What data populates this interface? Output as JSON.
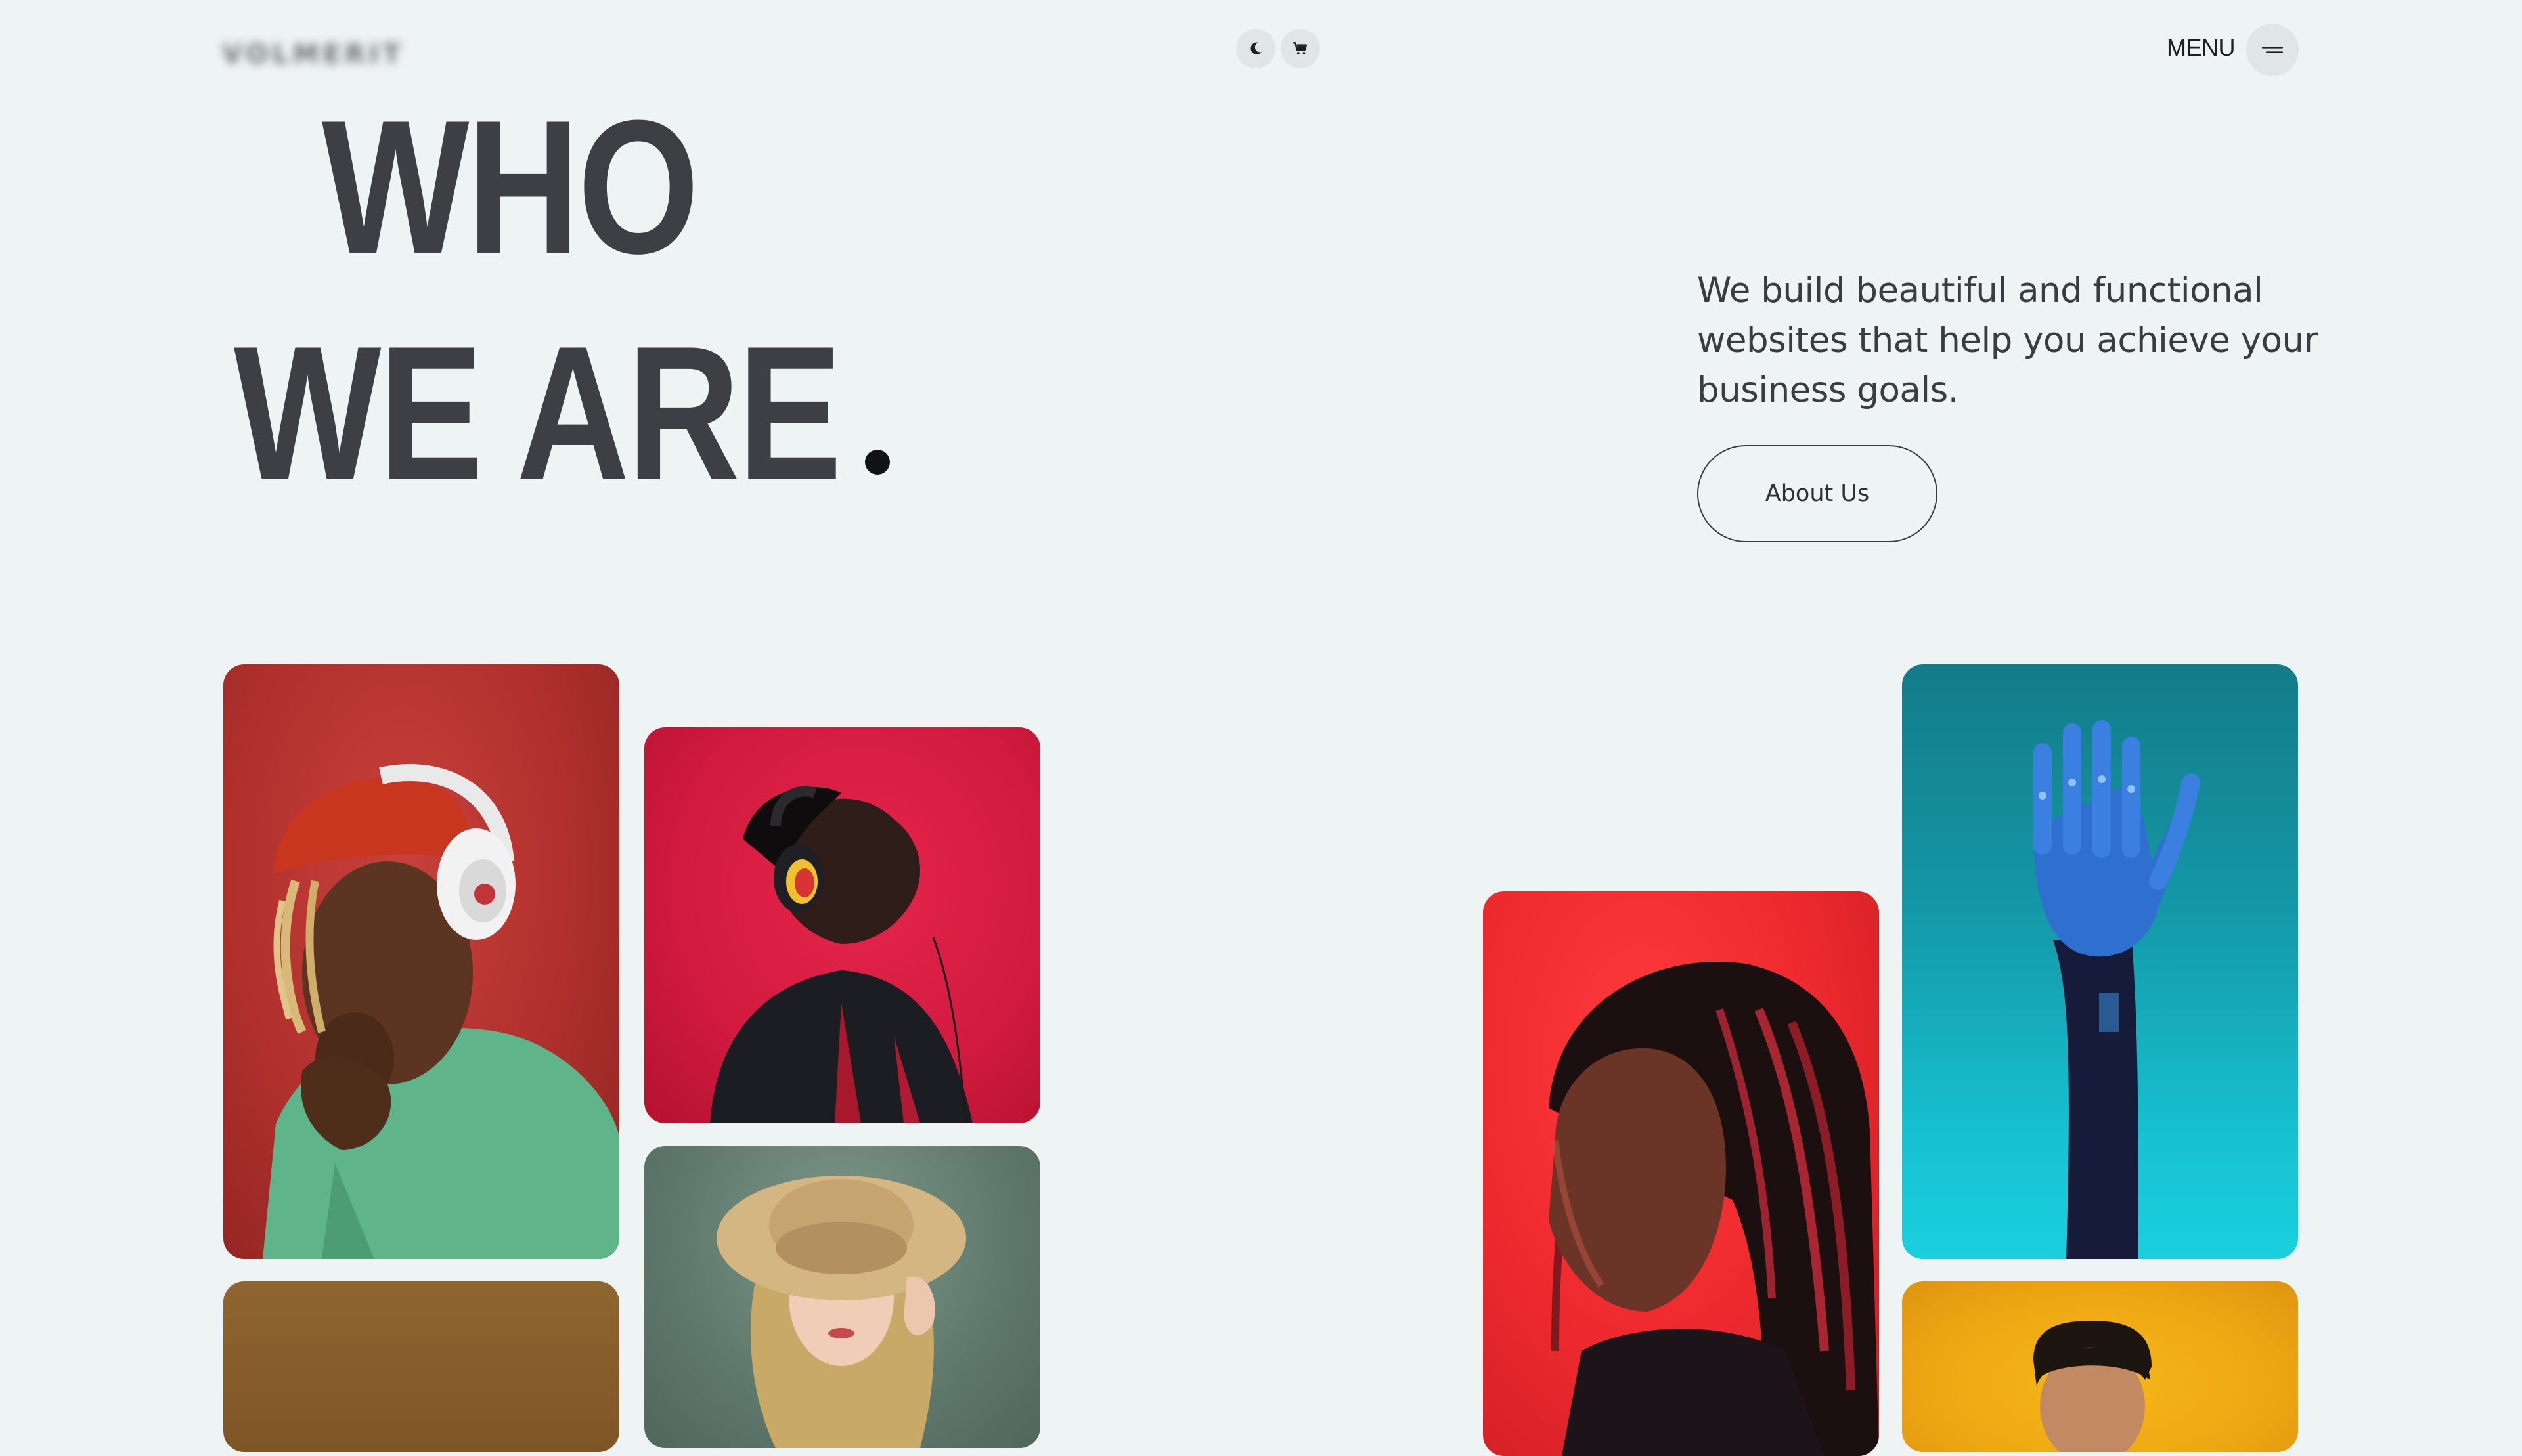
{
  "header": {
    "logo_text": "VOLMERIT",
    "menu_label": "MENU",
    "icons": {
      "theme": "moon-icon",
      "cart": "cart-icon",
      "menu": "hamburger-icon"
    }
  },
  "hero": {
    "title_line_1": "WHO",
    "title_line_2": "WE ARE",
    "description": "We build beautiful and functional websites that help you achieve your business goals.",
    "cta_label": "About Us"
  },
  "colors": {
    "background": "#eef3f3",
    "text": "#3e3f44",
    "dot": "#111214"
  },
  "gallery": {
    "cards": [
      {
        "name": "portrait-headphones-red"
      },
      {
        "name": "portrait-brown"
      },
      {
        "name": "portrait-profile-red"
      },
      {
        "name": "portrait-hat-green"
      },
      {
        "name": "portrait-braids"
      },
      {
        "name": "portrait-robot-hand"
      },
      {
        "name": "portrait-yellow"
      }
    ]
  }
}
